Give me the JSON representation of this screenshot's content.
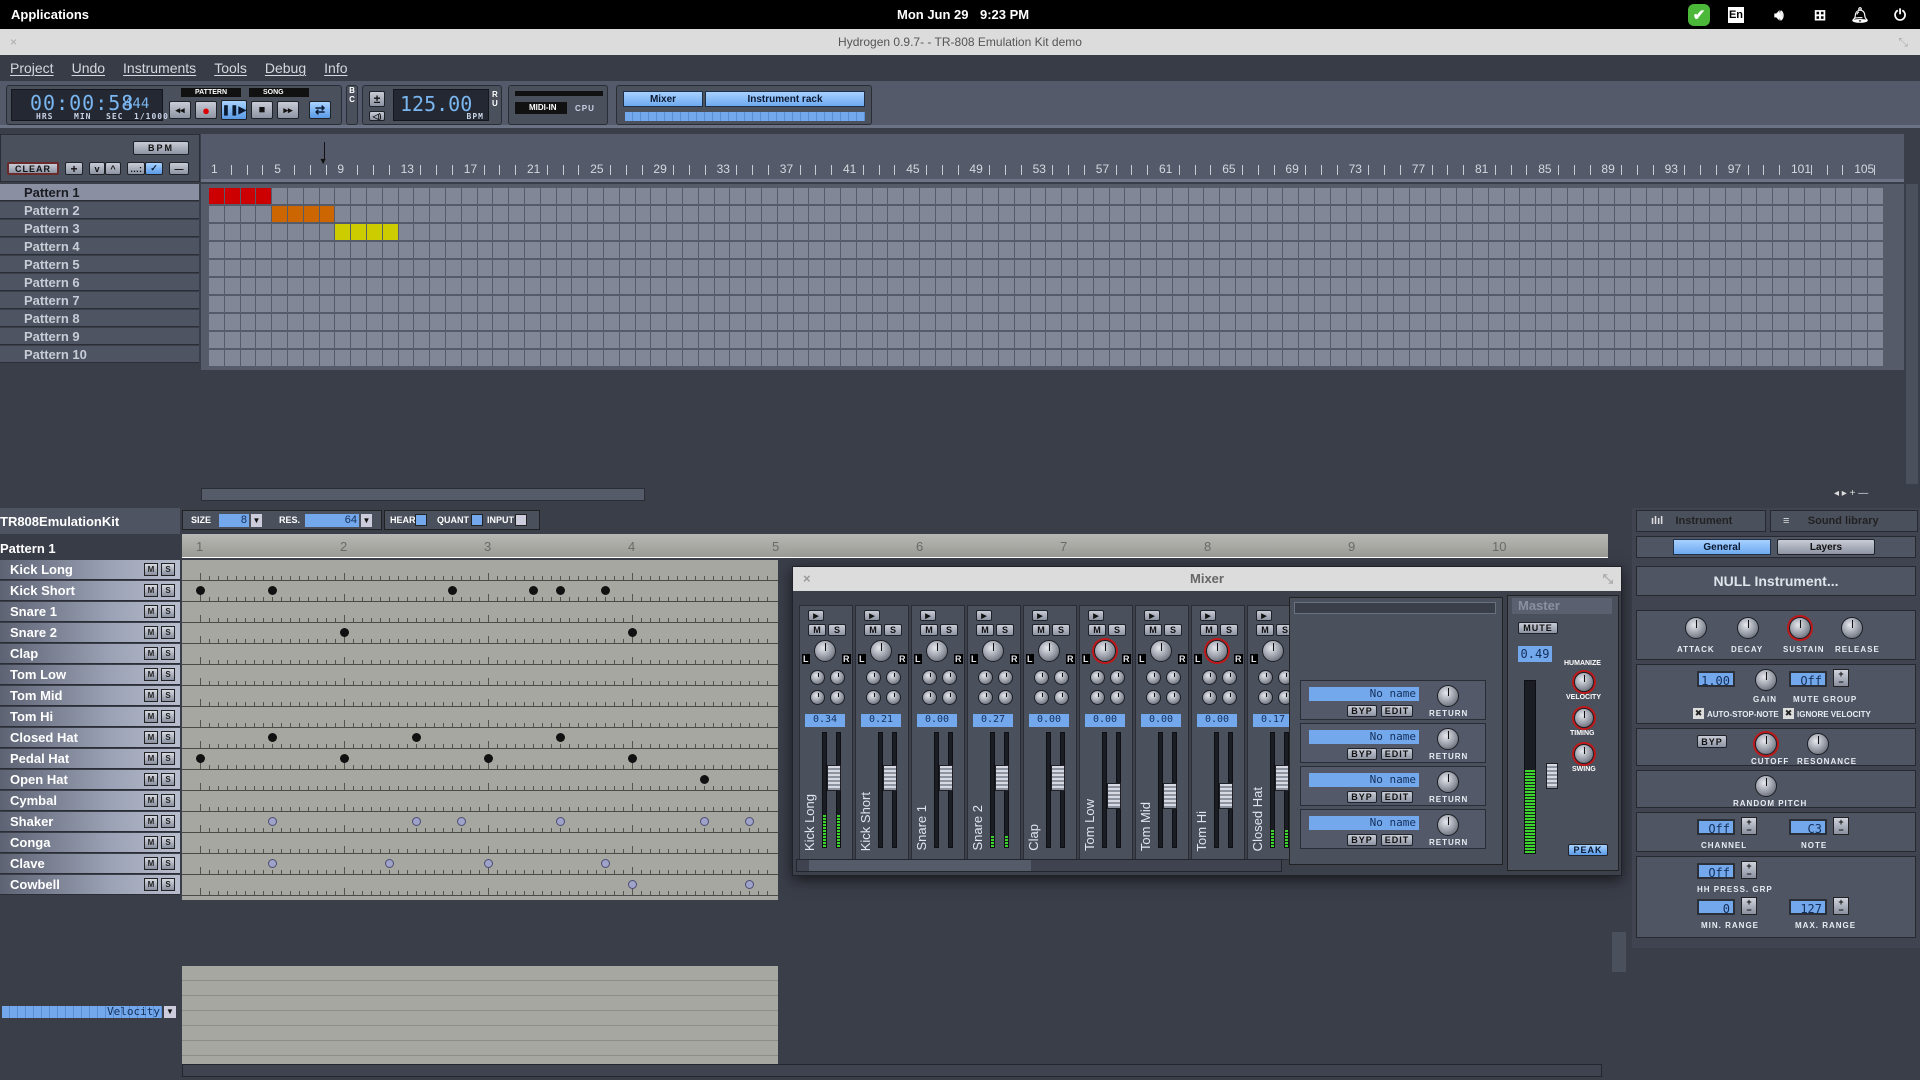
{
  "system_bar": {
    "apps_label": "Applications",
    "date": "Mon Jun 29",
    "time": "9:23 PM",
    "tray_icons": [
      "skype-status-icon",
      "keyboard-layout-icon",
      "volume-icon",
      "network-icon",
      "notification-bell-icon",
      "power-icon"
    ],
    "keyboard_layout": "En"
  },
  "window": {
    "title": "Hydrogen 0.9.7- - TR-808 Emulation Kit demo",
    "close_glyph": "×",
    "restore_glyph": "⤡"
  },
  "menu": [
    "Project",
    "Undo",
    "Instruments",
    "Tools",
    "Debug",
    "Info"
  ],
  "transport": {
    "time_display": "00:00:58",
    "time_ms": "444",
    "time_units": [
      "HRS",
      "MIN",
      "SEC",
      "1/1000"
    ],
    "mode_pattern": "PATTERN",
    "mode_song": "SONG",
    "mode_selected": "SONG",
    "buttons": [
      "rewind",
      "record",
      "play-pause",
      "stop",
      "fast-forward",
      "loop"
    ],
    "bc_label": "B C",
    "ru_label": "R U",
    "bpm_value": "125.00",
    "bpm_unit": "BPM",
    "midi_in_label": "MIDI-IN",
    "cpu_label": "CPU",
    "mixer_button": "Mixer",
    "instrument_rack_button": "Instrument rack"
  },
  "song_editor": {
    "bpm_button": "BPM",
    "clear_button": "CLEAR",
    "toolbar_glyphs": [
      "+",
      "v",
      "^",
      "...:",
      "✓",
      "—"
    ],
    "ruler_labels": [
      "1",
      "5",
      "9",
      "13",
      "17",
      "21",
      "25",
      "29",
      "33",
      "37",
      "41",
      "45",
      "49",
      "53",
      "57",
      "61",
      "65",
      "69",
      "73",
      "77",
      "81",
      "85",
      "89",
      "93",
      "97",
      "101",
      "105"
    ],
    "playhead_bar": 8,
    "patterns": [
      "Pattern 1",
      "Pattern 2",
      "Pattern 3",
      "Pattern 4",
      "Pattern 5",
      "Pattern 6",
      "Pattern 7",
      "Pattern 8",
      "Pattern 9",
      "Pattern 10"
    ],
    "selected_pattern": "Pattern 1",
    "active_cells": [
      {
        "pattern": 0,
        "bars": [
          1,
          2,
          3,
          4
        ],
        "color": "#cc0000"
      },
      {
        "pattern": 1,
        "bars": [
          5,
          6,
          7,
          8
        ],
        "color": "#cc6600"
      },
      {
        "pattern": 2,
        "bars": [
          9,
          10,
          11,
          12
        ],
        "color": "#cccc00"
      }
    ],
    "visible_bars": 106
  },
  "pattern_editor": {
    "drumkit_name": "TR808EmulationKit",
    "pattern_name": "Pattern 1",
    "size_label": "SIZE",
    "size_value": "8",
    "res_label": "RES.",
    "res_value": "64",
    "hear_label": "HEAR",
    "quant_label": "QUANT",
    "input_label": "INPUT",
    "ruler_beats": [
      "1",
      "2",
      "3",
      "4",
      "5",
      "6",
      "7",
      "8",
      "9",
      "10"
    ],
    "mute_label": "M",
    "solo_label": "S",
    "instruments": [
      {
        "name": "Kick Long",
        "notes": []
      },
      {
        "name": "Kick Short",
        "notes": [
          {
            "beat": 0,
            "soft": false
          },
          {
            "beat": 0.5,
            "soft": false
          },
          {
            "beat": 1.75,
            "soft": false
          },
          {
            "beat": 2.3125,
            "soft": false
          },
          {
            "beat": 2.5,
            "soft": false
          },
          {
            "beat": 2.8125,
            "soft": false
          }
        ]
      },
      {
        "name": "Snare 1",
        "notes": []
      },
      {
        "name": "Snare 2",
        "notes": [
          {
            "beat": 1,
            "soft": false
          },
          {
            "beat": 3,
            "soft": false
          }
        ]
      },
      {
        "name": "Clap",
        "notes": []
      },
      {
        "name": "Tom Low",
        "notes": []
      },
      {
        "name": "Tom Mid",
        "notes": []
      },
      {
        "name": "Tom Hi",
        "notes": []
      },
      {
        "name": "Closed Hat",
        "notes": [
          {
            "beat": 0.5,
            "soft": false
          },
          {
            "beat": 1.5,
            "soft": false
          },
          {
            "beat": 2.5,
            "soft": false
          }
        ]
      },
      {
        "name": "Pedal Hat",
        "notes": [
          {
            "beat": 0,
            "soft": false
          },
          {
            "beat": 1,
            "soft": false
          },
          {
            "beat": 2,
            "soft": false
          },
          {
            "beat": 3,
            "soft": false
          }
        ]
      },
      {
        "name": "Open Hat",
        "notes": [
          {
            "beat": 3.5,
            "soft": false
          }
        ]
      },
      {
        "name": "Cymbal",
        "notes": []
      },
      {
        "name": "Shaker",
        "notes": [
          {
            "beat": 0.5,
            "soft": true
          },
          {
            "beat": 1.5,
            "soft": true
          },
          {
            "beat": 1.8125,
            "soft": true
          },
          {
            "beat": 2.5,
            "soft": true
          },
          {
            "beat": 3.5,
            "soft": true
          },
          {
            "beat": 3.8125,
            "soft": true
          }
        ]
      },
      {
        "name": "Conga",
        "notes": []
      },
      {
        "name": "Clave",
        "notes": [
          {
            "beat": 0.5,
            "soft": true
          },
          {
            "beat": 1.3125,
            "soft": true
          },
          {
            "beat": 2,
            "soft": true
          },
          {
            "beat": 2.8125,
            "soft": true
          }
        ]
      },
      {
        "name": "Cowbell",
        "notes": [
          {
            "beat": 3,
            "soft": true
          },
          {
            "beat": 3.8125,
            "soft": true
          }
        ]
      }
    ],
    "property_selector": "Velocity"
  },
  "mixer": {
    "title": "Mixer",
    "channels": [
      {
        "name": "Kick Long",
        "volume": "0.34",
        "pan": "center",
        "meter": 0.28,
        "fader": 0.6
      },
      {
        "name": "Kick Short",
        "volume": "0.21",
        "pan": "center",
        "meter": 0,
        "fader": 0.6
      },
      {
        "name": "Snare 1",
        "volume": "0.00",
        "pan": "center",
        "meter": 0,
        "fader": 0.6
      },
      {
        "name": "Snare 2",
        "volume": "0.27",
        "pan": "center",
        "meter": 0.1,
        "fader": 0.6
      },
      {
        "name": "Clap",
        "volume": "0.00",
        "pan": "center",
        "meter": 0,
        "fader": 0.6
      },
      {
        "name": "Tom Low",
        "volume": "0.00",
        "pan": "left",
        "meter": 0,
        "fader": 0.45
      },
      {
        "name": "Tom Mid",
        "volume": "0.00",
        "pan": "center",
        "meter": 0,
        "fader": 0.45
      },
      {
        "name": "Tom Hi",
        "volume": "0.00",
        "pan": "right",
        "meter": 0,
        "fader": 0.45
      },
      {
        "name": "Closed Hat",
        "volume": "0.17",
        "pan": "center",
        "meter": 0.15,
        "fader": 0.6
      }
    ],
    "pan_left": "L",
    "pan_right": "R",
    "mute": "M",
    "solo": "S",
    "fx_slots": [
      {
        "name": "No name",
        "bypass": "BYP",
        "edit": "EDIT",
        "return": "RETURN"
      },
      {
        "name": "No name",
        "bypass": "BYP",
        "edit": "EDIT",
        "return": "RETURN"
      },
      {
        "name": "No name",
        "bypass": "BYP",
        "edit": "EDIT",
        "return": "RETURN"
      },
      {
        "name": "No name",
        "bypass": "BYP",
        "edit": "EDIT",
        "return": "RETURN"
      }
    ],
    "master": {
      "label": "Master",
      "mute": "MUTE",
      "volume": "0.49",
      "humanize_label": "HUMANIZE",
      "knobs": [
        "VELOCITY",
        "TIMING",
        "SWING"
      ],
      "peak": "PEAK",
      "meter": 0.48,
      "fader": 0.45
    }
  },
  "instrument_rack": {
    "tab_instrument": "Instrument",
    "tab_sound_library": "Sound library",
    "subtab_general": "General",
    "subtab_layers": "Layers",
    "instrument_name": "NULL Instrument...",
    "adsr": [
      "ATTACK",
      "DECAY",
      "SUSTAIN",
      "RELEASE"
    ],
    "gain_value": "1.00",
    "gain_label": "GAIN",
    "mute_group_value": "Off",
    "mute_group_label": "MUTE GROUP",
    "auto_stop_note": "AUTO-STOP-NOTE",
    "ignore_velocity": "IGNORE VELOCITY",
    "filter_bypass": "BYP",
    "cutoff_label": "CUTOFF",
    "resonance_label": "RESONANCE",
    "random_pitch_label": "RANDOM PITCH",
    "channel_value": "Off",
    "channel_label": "CHANNEL",
    "note_value": "C3",
    "note_label": "NOTE",
    "hh_press_value": "Off",
    "hh_press_label": "HH PRESS. GRP",
    "min_range_value": "0",
    "min_range_label": "MIN. RANGE",
    "max_range_value": "127",
    "max_range_label": "MAX. RANGE"
  },
  "colors": {
    "accent_blue": "#74a8ec",
    "pattern1": "#cc0000",
    "pattern2": "#cc6600",
    "pattern3": "#cccc00",
    "meter_green": "#3bd52c"
  }
}
